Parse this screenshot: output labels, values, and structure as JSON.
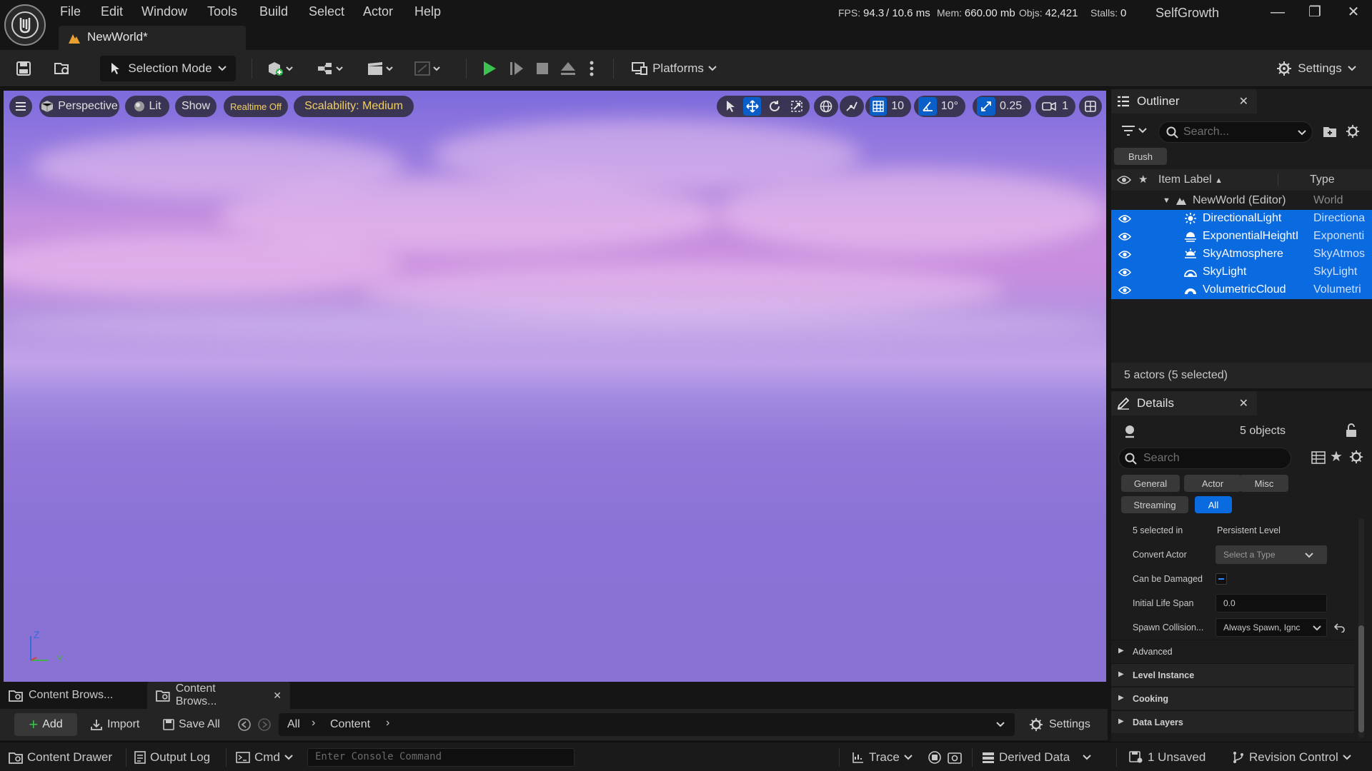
{
  "menu": [
    "File",
    "Edit",
    "Window",
    "Tools",
    "Build",
    "Select",
    "Actor",
    "Help"
  ],
  "level_tab": {
    "label": "NewWorld*"
  },
  "stats": {
    "fps_label": "FPS:",
    "fps": "94.3",
    "ms": "/ 10.6 ms",
    "mem_label": "Mem:",
    "mem": "660.00 mb",
    "objs_label": "Objs:",
    "objs": "42,421",
    "stalls_label": "Stalls:",
    "stalls": "0"
  },
  "project_name": "SelfGrowth",
  "window_controls": {
    "minimize": "—",
    "maximize": "❐",
    "close": "✕"
  },
  "toolbar": {
    "selection_mode": "Selection Mode",
    "platforms": "Platforms",
    "settings": "Settings"
  },
  "viewport": {
    "perspective": "Perspective",
    "lit": "Lit",
    "show": "Show",
    "realtime": "Realtime Off",
    "scalability": "Scalability: Medium",
    "grid_snap": "10",
    "rot_snap": "10°",
    "scale_snap": "0.25",
    "camera_speed": "1",
    "axis_z": "Z",
    "axis_y": "Y",
    "colors": {
      "realtime_text": "#f0d060",
      "scalability_text": "#f0d060",
      "active_icon": "#0a5ec7"
    }
  },
  "content_browser": {
    "tabs": [
      "Content Brows...",
      "Content Brows..."
    ],
    "add": "Add",
    "import": "Import",
    "save_all": "Save All",
    "path": [
      "All",
      "Content"
    ],
    "settings": "Settings"
  },
  "statusbar": {
    "content_drawer": "Content Drawer",
    "output_log": "Output Log",
    "cmd": "Cmd",
    "console_placeholder": "Enter Console Command",
    "trace": "Trace",
    "derived_data": "Derived Data",
    "unsaved": "1 Unsaved",
    "revision_control": "Revision Control"
  },
  "outliner": {
    "title": "Outliner",
    "search_placeholder": "Search...",
    "brush_filter": "Brush",
    "col_label": "Item Label",
    "col_type": "Type",
    "world": {
      "label": "NewWorld (Editor)",
      "type": "World"
    },
    "items": [
      {
        "label": "DirectionalLight",
        "type": "Directiona",
        "icon": "directional-light-icon"
      },
      {
        "label": "ExponentialHeightI",
        "type": "Exponenti",
        "icon": "height-fog-icon"
      },
      {
        "label": "SkyAtmosphere",
        "type": "SkyAtmos",
        "icon": "sky-atmosphere-icon"
      },
      {
        "label": "SkyLight",
        "type": "SkyLight",
        "icon": "sky-light-icon"
      },
      {
        "label": "VolumetricCloud",
        "type": "Volumetri",
        "icon": "volumetric-cloud-icon"
      }
    ],
    "footer": "5 actors (5 selected)",
    "colors": {
      "selected_row": "#0a6adf"
    }
  },
  "details": {
    "title": "Details",
    "objects": "5 objects",
    "search_placeholder": "Search",
    "filters": [
      "General",
      "Actor",
      "Misc",
      "Streaming",
      "All"
    ],
    "active_filter": "All",
    "props": {
      "selected_in_label": "5 selected in",
      "selected_in_value": "Persistent Level",
      "convert_actor_label": "Convert Actor",
      "convert_actor_value": "Select a Type",
      "can_be_damaged_label": "Can be Damaged",
      "initial_life_span_label": "Initial Life Span",
      "initial_life_span_value": "0.0",
      "spawn_collision_label": "Spawn Collision...",
      "spawn_collision_value": "Always Spawn, Ignc"
    },
    "categories": [
      "Advanced",
      "Level Instance",
      "Cooking",
      "Data Layers"
    ]
  }
}
